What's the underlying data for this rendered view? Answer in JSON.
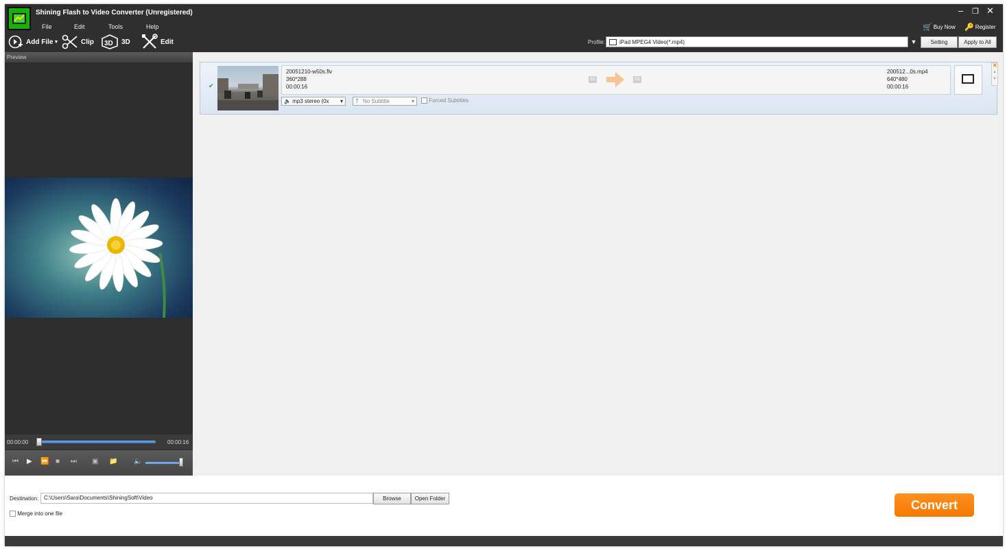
{
  "window": {
    "title": "Shining Flash to Video Converter (Unregistered)"
  },
  "menu": [
    "File",
    "Edit",
    "Tools",
    "Help"
  ],
  "toolbar": {
    "add_file": "Add File",
    "clip": "Clip",
    "three_d": "3D",
    "edit": "Edit"
  },
  "top_links": {
    "buy_now": "Buy Now",
    "register": "Register"
  },
  "profile": {
    "label": "Profile:",
    "value": "iPad MPEG4 Video(*.mp4)",
    "setting": "Setting",
    "apply_all": "Apply to All"
  },
  "preview": {
    "header": "Preview",
    "time_start": "00:00:00",
    "time_end": "00:00:16"
  },
  "file": {
    "source_name": "20051210-w50s.flv",
    "source_res": "360*288",
    "source_dur": "00:00:16",
    "badge_in": "2D",
    "badge_out": "2D",
    "output_name": "200512...0s.mp4",
    "output_res": "640*480",
    "output_dur": "00:00:16",
    "audio": "mp3 stereo (0x",
    "subtitle": "No Subtitle",
    "forced": "Forced Subtitles"
  },
  "bottom": {
    "dest_label": "Destination:",
    "dest_path": "C:\\Users\\Sara\\Documents\\ShiningSoft\\Video",
    "browse": "Browse",
    "open_folder": "Open Folder",
    "merge": "Merge into one file",
    "convert": "Convert"
  },
  "colors": {
    "accent": "#f47a00",
    "titlebar": "#2f2f2f",
    "logo": "#14b300"
  }
}
